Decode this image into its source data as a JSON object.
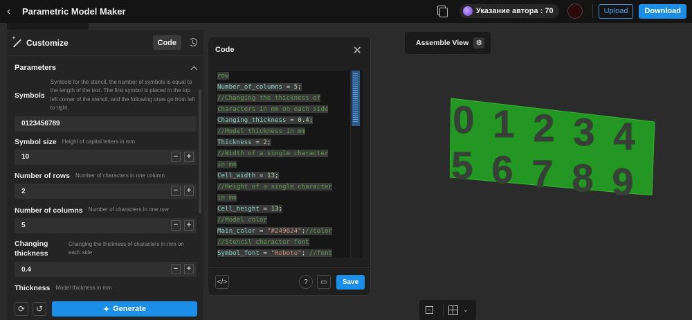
{
  "app": {
    "title": "Parametric Model Maker",
    "credit_label": "Указание автора : 70"
  },
  "topbar": {
    "upload_label": "Upload",
    "download_label": "Download"
  },
  "customize": {
    "title": "Customize",
    "code_label": "Code",
    "section_title": "Parameters",
    "params": [
      {
        "label": "Symbols",
        "desc": "Symbols for the stencil, the number of symbols is equal to the length of the text. The first symbol is placed in the top left corner of the stencil, and the following ones go from left to right.",
        "value": "0123456789"
      },
      {
        "label": "Symbol size",
        "desc": "Height of capital letters in mm",
        "value": "10"
      },
      {
        "label": "Number of rows",
        "desc": "Number of characters in one column",
        "value": "2"
      },
      {
        "label": "Number of columns",
        "desc": "Number of characters in one row",
        "value": "5"
      },
      {
        "label": "Changing thickness",
        "desc": "Changing the thickness of characters in mm on each side",
        "value": "0.4"
      },
      {
        "label": "Thickness",
        "desc": "Model thickness in mm",
        "value": ""
      }
    ],
    "generate_label": "Generate"
  },
  "code_modal": {
    "title": "Code",
    "save_label": "Save",
    "lines": [
      [
        [
          "cm",
          "row"
        ]
      ],
      [
        [
          "vr",
          "Number_of_columns"
        ],
        [
          "op",
          " = "
        ],
        [
          "num",
          "5"
        ],
        [
          "op",
          ";"
        ]
      ],
      [
        [
          "cm",
          "//Changing the thickness of"
        ]
      ],
      [
        [
          "cm",
          "characters in mm on each side"
        ]
      ],
      [
        [
          "vr",
          "Changing_thickness"
        ],
        [
          "op",
          " = "
        ],
        [
          "num",
          "0.4"
        ],
        [
          "op",
          ";"
        ]
      ],
      [
        [
          "cm",
          "//Model thickness in mm"
        ]
      ],
      [
        [
          "vr",
          "Thickness"
        ],
        [
          "op",
          " = "
        ],
        [
          "num",
          "2"
        ],
        [
          "op",
          ";"
        ]
      ],
      [
        [
          "cm",
          "//Width of a single character"
        ]
      ],
      [
        [
          "cm",
          "in mm"
        ]
      ],
      [
        [
          "vr",
          "Cell_width"
        ],
        [
          "op",
          " = "
        ],
        [
          "num",
          "13"
        ],
        [
          "op",
          ";"
        ]
      ],
      [
        [
          "cm",
          "//Height of a single character"
        ]
      ],
      [
        [
          "cm",
          "in mm"
        ]
      ],
      [
        [
          "vr",
          "Cell_height"
        ],
        [
          "op",
          " = "
        ],
        [
          "num",
          "13"
        ],
        [
          "op",
          ";"
        ]
      ],
      [
        [
          "cm",
          "//Model color"
        ]
      ],
      [
        [
          "vr",
          "Main_color"
        ],
        [
          "op",
          " = "
        ],
        [
          "str",
          "\"#249624\""
        ],
        [
          "op",
          ";"
        ],
        [
          "cm",
          "//color"
        ]
      ],
      [
        [
          "cm",
          "//Stencil character font"
        ]
      ],
      [
        [
          "vr",
          "Symbol_font"
        ],
        [
          "op",
          " = "
        ],
        [
          "str",
          "\"Roboto\""
        ],
        [
          "op",
          "; "
        ],
        [
          "cm",
          "//font"
        ]
      ]
    ]
  },
  "viewport": {
    "assemble_label": "Assemble View",
    "stencil_digits": [
      "0",
      "1",
      "2",
      "3",
      "4",
      "5",
      "6",
      "7",
      "8",
      "9"
    ],
    "model_color": "#249624"
  }
}
